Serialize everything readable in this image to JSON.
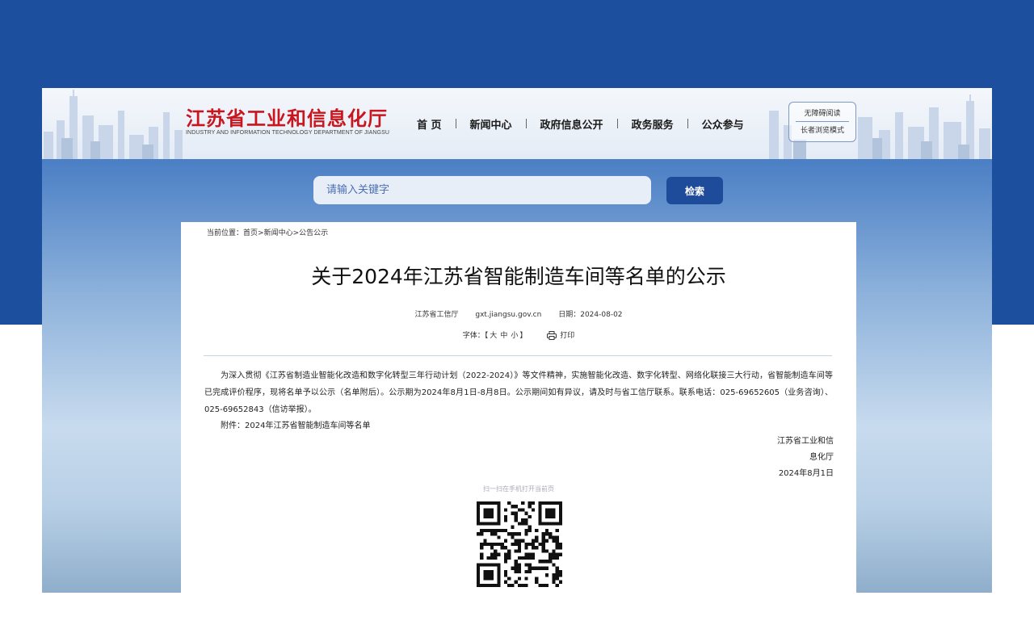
{
  "header": {
    "logo_cn": "江苏省工业和信息化厅",
    "logo_en": "INDUSTRY AND INFORMATION TECHNOLOGY DEPARTMENT OF JIANGSU",
    "nav": [
      "首 页",
      "新闻中心",
      "政府信息公开",
      "政务服务",
      "公众参与"
    ],
    "accessibility": {
      "barrier_free": "无障碍阅读",
      "elderly_mode": "长者浏览模式"
    }
  },
  "search": {
    "placeholder": "请输入关键字",
    "button_label": "检索"
  },
  "article": {
    "breadcrumb": {
      "prefix": "当前位置：",
      "items": [
        "首页",
        "新闻中心",
        "公告公示"
      ],
      "separator": ">"
    },
    "title": "关于2024年江苏省智能制造车间等名单的公示",
    "source": "江苏省工信厅",
    "site": "gxt.jiangsu.gov.cn",
    "date": "日期：2024-08-02",
    "font_label": "字体：",
    "font_sizes": [
      "大",
      "中",
      "小"
    ],
    "print_label": "打印",
    "body": "为深入贯彻《江苏省制造业智能化改造和数字化转型三年行动计划（2022-2024）》等文件精神，实施智能化改造、数字化转型、网络化联接三大行动，省智能制造车间等已完成评价程序，现将名单予以公示（名单附后）。公示期为2024年8月1日-8月8日。公示期间如有异议，请及时与省工信厅联系。联系电话：025-69652605（业务咨询）、025-69652843（信访举报）。",
    "attachment": "附件：2024年江苏省智能制造车间等名单",
    "signature": [
      "江苏省工业和信",
      "息化厅",
      "2024年8月1日"
    ],
    "qr_caption": "扫一扫在手机打开当前页"
  },
  "colors": {
    "brand_red": "#c9151e",
    "primary_blue": "#1e4c9b",
    "band_blue": "#1d4f9f"
  },
  "icons": [
    "printer-icon",
    "qr-code-icon"
  ]
}
